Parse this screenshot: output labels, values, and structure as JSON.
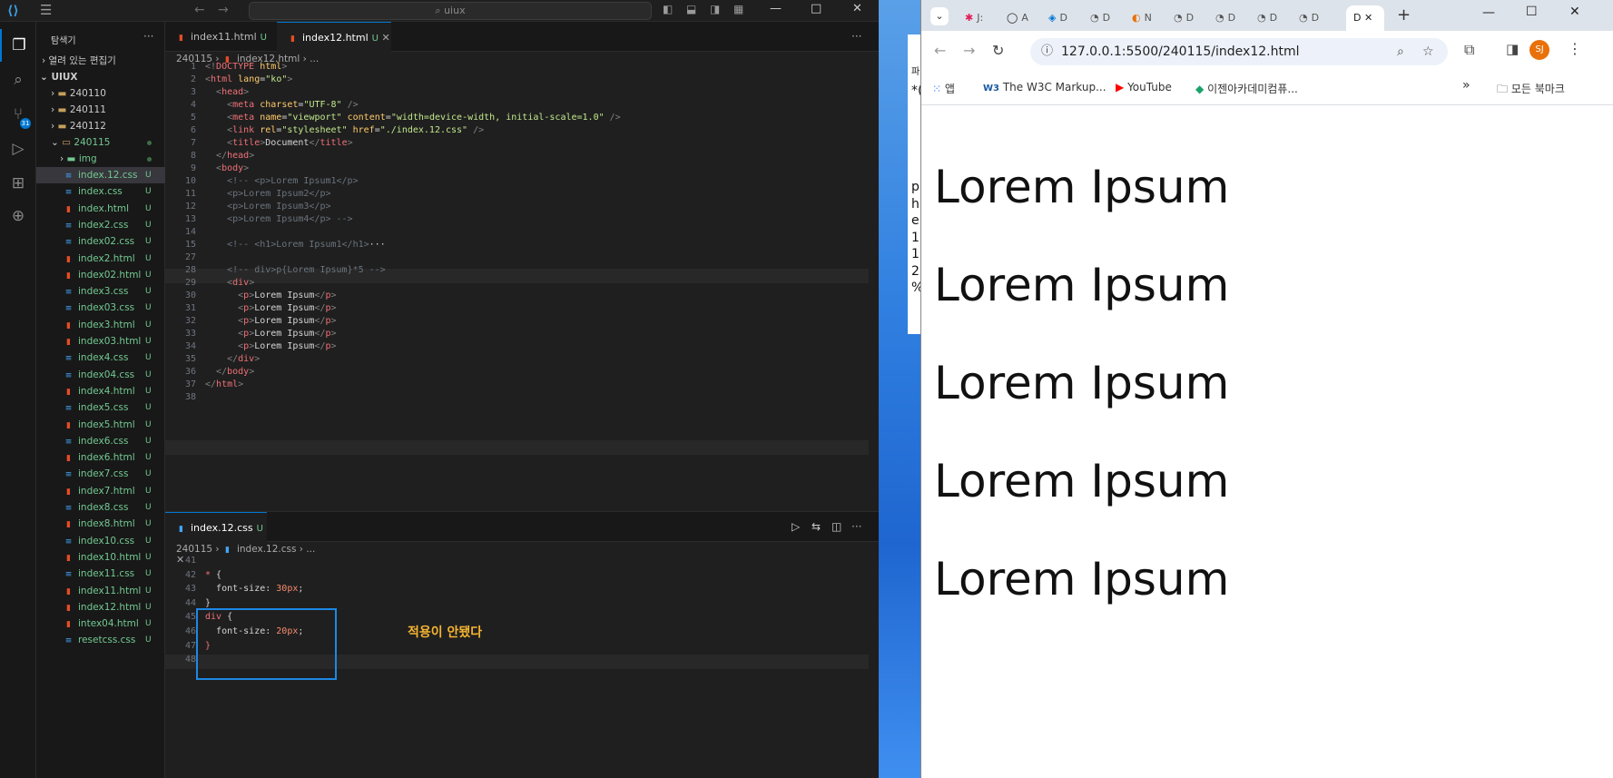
{
  "vscode": {
    "search_text": "uiux",
    "sidebar": {
      "title": "탐색기",
      "open_editors": "열려 있는 편집기",
      "root": "UIUX",
      "folders": [
        "240110",
        "240111",
        "240112",
        "240115",
        "img"
      ],
      "files": [
        {
          "name": "index.12.css",
          "type": "css",
          "status": "U"
        },
        {
          "name": "index.css",
          "type": "css",
          "status": "U"
        },
        {
          "name": "index.html",
          "type": "html",
          "status": "U"
        },
        {
          "name": "index2.css",
          "type": "css",
          "status": "U"
        },
        {
          "name": "index02.css",
          "type": "css",
          "status": "U"
        },
        {
          "name": "index2.html",
          "type": "html",
          "status": "U"
        },
        {
          "name": "index02.html",
          "type": "html",
          "status": "U"
        },
        {
          "name": "index3.css",
          "type": "css",
          "status": "U"
        },
        {
          "name": "index03.css",
          "type": "css",
          "status": "U"
        },
        {
          "name": "index3.html",
          "type": "html",
          "status": "U"
        },
        {
          "name": "index03.html",
          "type": "html",
          "status": "U"
        },
        {
          "name": "index4.css",
          "type": "css",
          "status": "U"
        },
        {
          "name": "index04.css",
          "type": "css",
          "status": "U"
        },
        {
          "name": "index4.html",
          "type": "html",
          "status": "U"
        },
        {
          "name": "index5.css",
          "type": "css",
          "status": "U"
        },
        {
          "name": "index5.html",
          "type": "html",
          "status": "U"
        },
        {
          "name": "index6.css",
          "type": "css",
          "status": "U"
        },
        {
          "name": "index6.html",
          "type": "html",
          "status": "U"
        },
        {
          "name": "index7.css",
          "type": "css",
          "status": "U"
        },
        {
          "name": "index7.html",
          "type": "html",
          "status": "U"
        },
        {
          "name": "index8.css",
          "type": "css",
          "status": "U"
        },
        {
          "name": "index8.html",
          "type": "html",
          "status": "U"
        },
        {
          "name": "index10.css",
          "type": "css",
          "status": "U"
        },
        {
          "name": "index10.html",
          "type": "html",
          "status": "U"
        },
        {
          "name": "index11.css",
          "type": "css",
          "status": "U"
        },
        {
          "name": "index11.html",
          "type": "html",
          "status": "U"
        },
        {
          "name": "index12.html",
          "type": "html",
          "status": "U"
        },
        {
          "name": "intex04.html",
          "type": "html",
          "status": "U"
        },
        {
          "name": "resetcss.css",
          "type": "css",
          "status": "U"
        }
      ]
    },
    "badge_count": "31",
    "top_tabs": [
      {
        "name": "index11.html",
        "mod": "U"
      },
      {
        "name": "index12.html",
        "mod": "U"
      }
    ],
    "top_breadcrumb": [
      "240115",
      "index12.html",
      "..."
    ],
    "bottom_tab": {
      "name": "index.12.css",
      "mod": "U"
    },
    "bottom_breadcrumb": [
      "240115",
      "index.12.css",
      "..."
    ],
    "annotation": "적용이 안됐다"
  },
  "browser": {
    "url": "127.0.0.1:5500/240115/index12.html",
    "tab_titles": [
      "J:",
      "A",
      "D",
      "D",
      "N",
      "D",
      "D",
      "D",
      "D"
    ],
    "active_tab_title": "D",
    "bookmarks": [
      "앱",
      "The W3C Markup...",
      "YouTube",
      "이젠아카데미컴퓨...",
      "모든 북마크"
    ],
    "profile_initials": "SJ",
    "page_paragraphs": [
      "Lorem Ipsum",
      "Lorem Ipsum",
      "Lorem Ipsum",
      "Lorem Ipsum",
      "Lorem Ipsum"
    ]
  },
  "desktop_text": [
    "*(",
    "p",
    "h",
    "e",
    "1(",
    "1:",
    "2",
    "%"
  ],
  "desktop_top": "파",
  "colors": {
    "accent": "#0078d4",
    "annotation": "#f5b431",
    "box": "#1e88e5"
  }
}
